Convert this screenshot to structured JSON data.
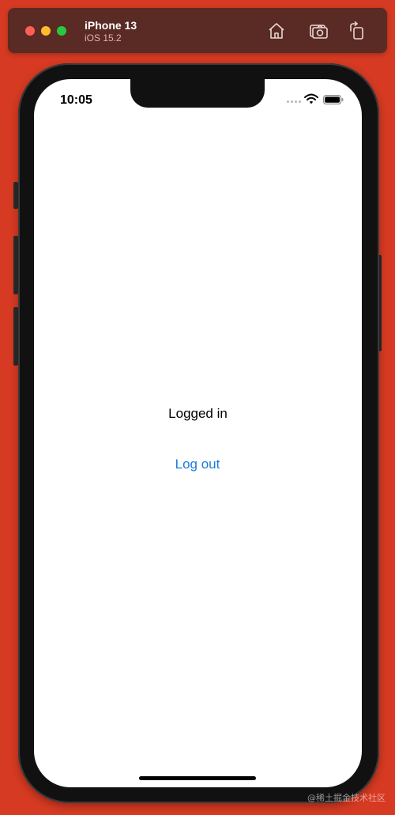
{
  "simulator": {
    "device_name": "iPhone 13",
    "os_version": "iOS 15.2",
    "toolbar": [
      {
        "icon": "home-icon",
        "label": "Home"
      },
      {
        "icon": "screenshot-icon",
        "label": "Save Screen"
      },
      {
        "icon": "rotate-icon",
        "label": "Rotate"
      }
    ]
  },
  "status_bar": {
    "time": "10:05",
    "icons": [
      "cellular-icon",
      "wifi-icon",
      "battery-icon"
    ]
  },
  "screen": {
    "status_label": "Logged in",
    "logout_label": "Log out"
  },
  "watermark": "@稀土掘金技术社区",
  "colors": {
    "background": "#d63a22",
    "title_bar": "#5a2a24",
    "link_blue": "#1a7bdc"
  }
}
